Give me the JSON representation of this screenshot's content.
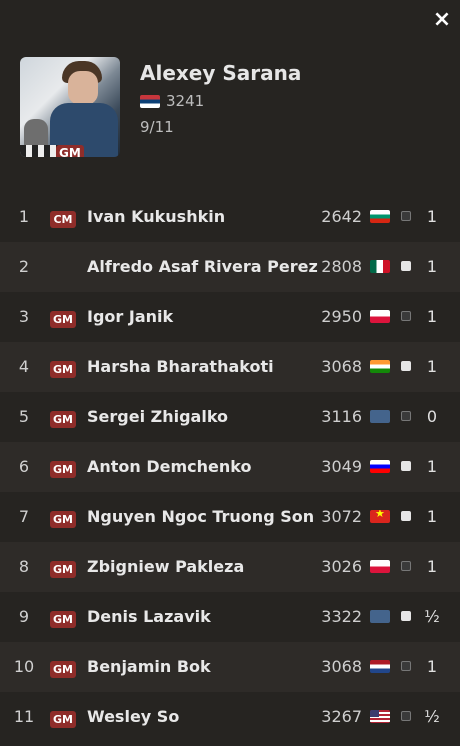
{
  "close_icon": "×",
  "player": {
    "name": "Alexey Sarana",
    "title": "GM",
    "flag": "serbia",
    "rating": "3241",
    "score": "9/11"
  },
  "rounds": [
    {
      "rank": "1",
      "title": "CM",
      "name": "Ivan Kukushkin",
      "rating": "2642",
      "flag": "bulgaria",
      "color": "black",
      "result": "1"
    },
    {
      "rank": "2",
      "title": "",
      "name": "Alfredo Asaf Rivera Perez",
      "rating": "2808",
      "flag": "mexico",
      "color": "white",
      "result": "1"
    },
    {
      "rank": "3",
      "title": "GM",
      "name": "Igor Janik",
      "rating": "2950",
      "flag": "poland",
      "color": "black",
      "result": "1"
    },
    {
      "rank": "4",
      "title": "GM",
      "name": "Harsha Bharathakoti",
      "rating": "3068",
      "flag": "india",
      "color": "white",
      "result": "1"
    },
    {
      "rank": "5",
      "title": "GM",
      "name": "Sergei Zhigalko",
      "rating": "3116",
      "flag": "blank",
      "color": "black",
      "result": "0"
    },
    {
      "rank": "6",
      "title": "GM",
      "name": "Anton Demchenko",
      "rating": "3049",
      "flag": "slovenia",
      "color": "white",
      "result": "1"
    },
    {
      "rank": "7",
      "title": "GM",
      "name": "Nguyen Ngoc Truong Son",
      "rating": "3072",
      "flag": "vietnam",
      "color": "white",
      "result": "1"
    },
    {
      "rank": "8",
      "title": "GM",
      "name": "Zbigniew Pakleza",
      "rating": "3026",
      "flag": "poland",
      "color": "black",
      "result": "1"
    },
    {
      "rank": "9",
      "title": "GM",
      "name": "Denis Lazavik",
      "rating": "3322",
      "flag": "blank",
      "color": "white",
      "result": "½"
    },
    {
      "rank": "10",
      "title": "GM",
      "name": "Benjamin Bok",
      "rating": "3068",
      "flag": "netherlands",
      "color": "black",
      "result": "1"
    },
    {
      "rank": "11",
      "title": "GM",
      "name": "Wesley So",
      "rating": "3267",
      "flag": "usa",
      "color": "black",
      "result": "½"
    }
  ]
}
